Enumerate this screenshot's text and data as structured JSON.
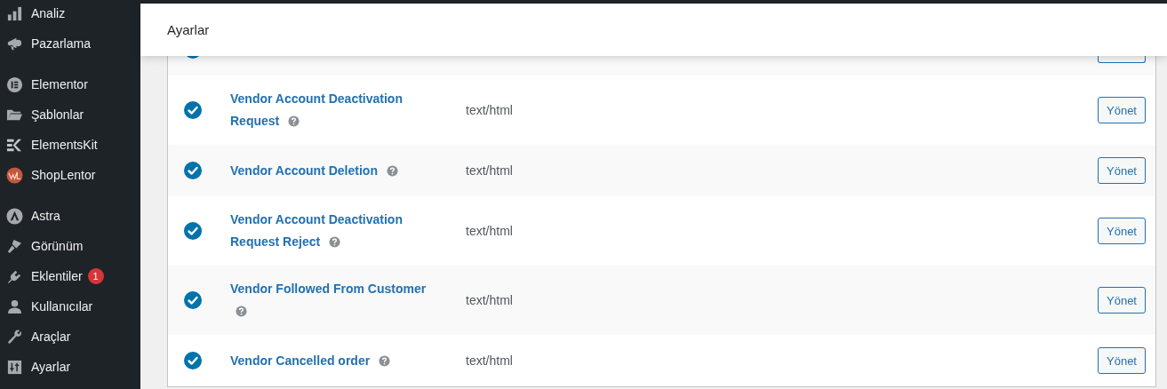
{
  "sidebar": {
    "groups": [
      {
        "items": [
          {
            "label": "Analiz"
          },
          {
            "label": "Pazarlama"
          }
        ]
      },
      {
        "items": [
          {
            "label": "Elementor"
          },
          {
            "label": "Şablonlar"
          },
          {
            "label": "ElementsKit"
          },
          {
            "label": "ShopLentor"
          }
        ]
      },
      {
        "items": [
          {
            "label": "Astra"
          },
          {
            "label": "Görünüm"
          },
          {
            "label": "Eklentiler",
            "badge": "1"
          },
          {
            "label": "Kullanıcılar"
          },
          {
            "label": "Araçlar"
          },
          {
            "label": "Ayarlar"
          }
        ]
      }
    ]
  },
  "header": {
    "title": "Ayarlar"
  },
  "hidden_row": {
    "enabled": true
  },
  "emails": [
    {
      "name": "Vendor Account Deactivation Request",
      "enabled": true,
      "content_type": "text/html",
      "action": "Yönet"
    },
    {
      "name": "Vendor Account Deletion",
      "enabled": true,
      "content_type": "text/html",
      "action": "Yönet"
    },
    {
      "name": "Vendor Account Deactivation Request Reject",
      "enabled": true,
      "content_type": "text/html",
      "action": "Yönet"
    },
    {
      "name": "Vendor Followed From Customer",
      "enabled": true,
      "content_type": "text/html",
      "action": "Yönet"
    },
    {
      "name": "Vendor Cancelled order",
      "enabled": true,
      "content_type": "text/html",
      "action": "Yönet"
    }
  ]
}
